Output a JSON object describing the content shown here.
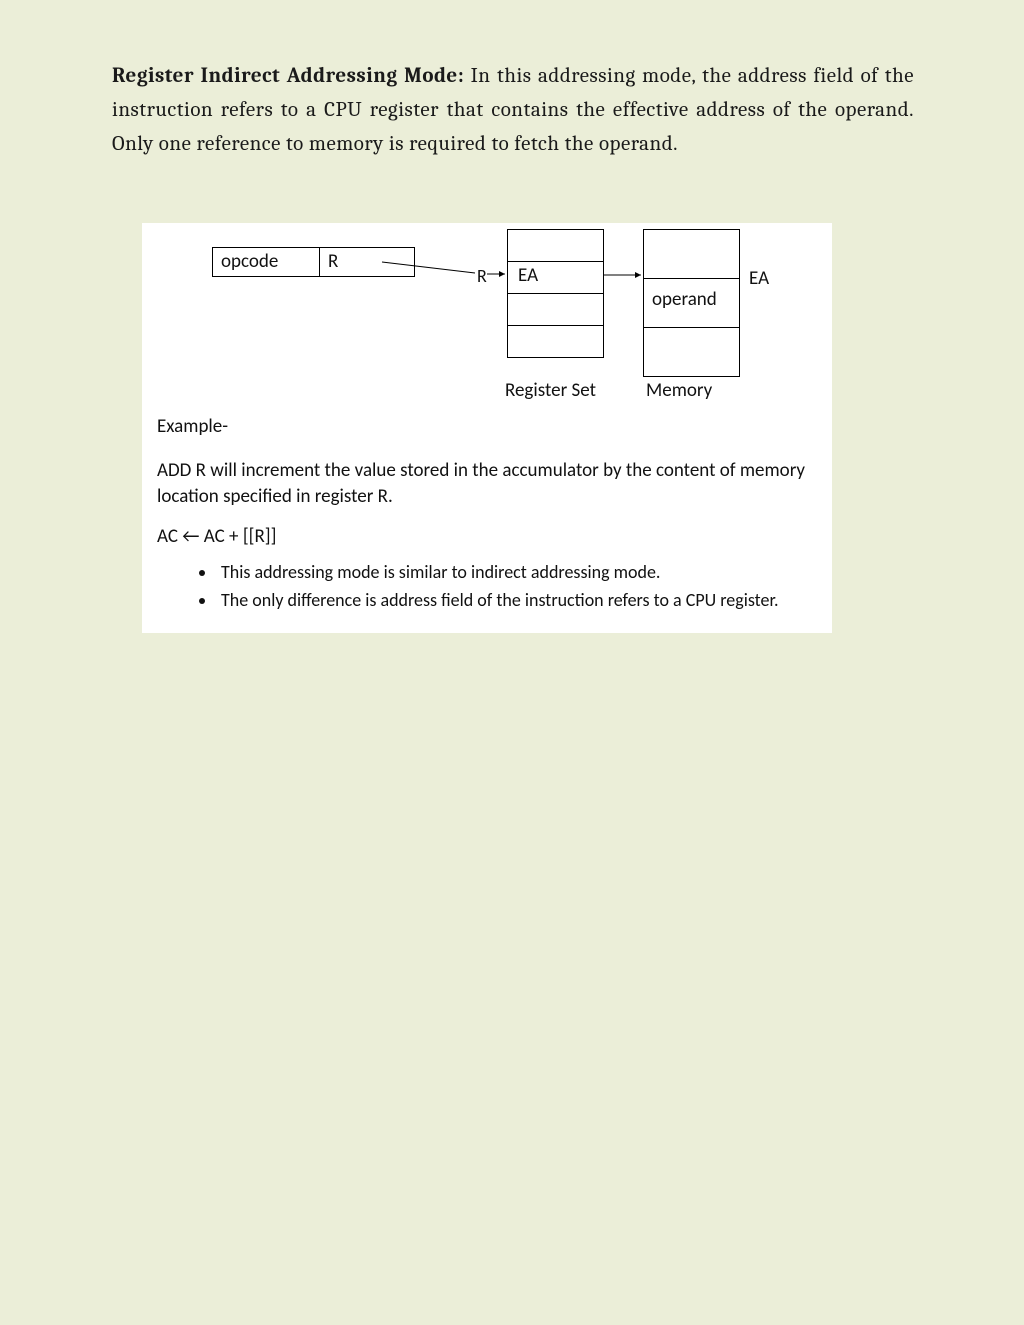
{
  "intro": {
    "title": "Register Indirect Addressing Mode:",
    "body": "In this addressing  mode,  the  address field of the instruction refers to a CPU register that contains  the  effective address of the operand. Only one reference to memory is required to fetch the operand."
  },
  "diagram": {
    "instr": {
      "opcode": "opcode",
      "reg": "R"
    },
    "midLabel": "R",
    "regset": {
      "rows": [
        "",
        "EA",
        "",
        ""
      ],
      "caption": "Register Set"
    },
    "memory": {
      "rows": [
        "",
        "operand",
        ""
      ],
      "caption": "Memory",
      "sideLabel": "EA"
    }
  },
  "example": {
    "heading": "Example-",
    "body": " ADD R will increment the value stored in the accumulator by the content of memory location specified in register R.",
    "formula": "AC ← AC + [[R]]",
    "bullets": [
      "This addressing mode is similar to indirect addressing mode.",
      "The only difference is address field of the instruction refers to a CPU register."
    ]
  }
}
